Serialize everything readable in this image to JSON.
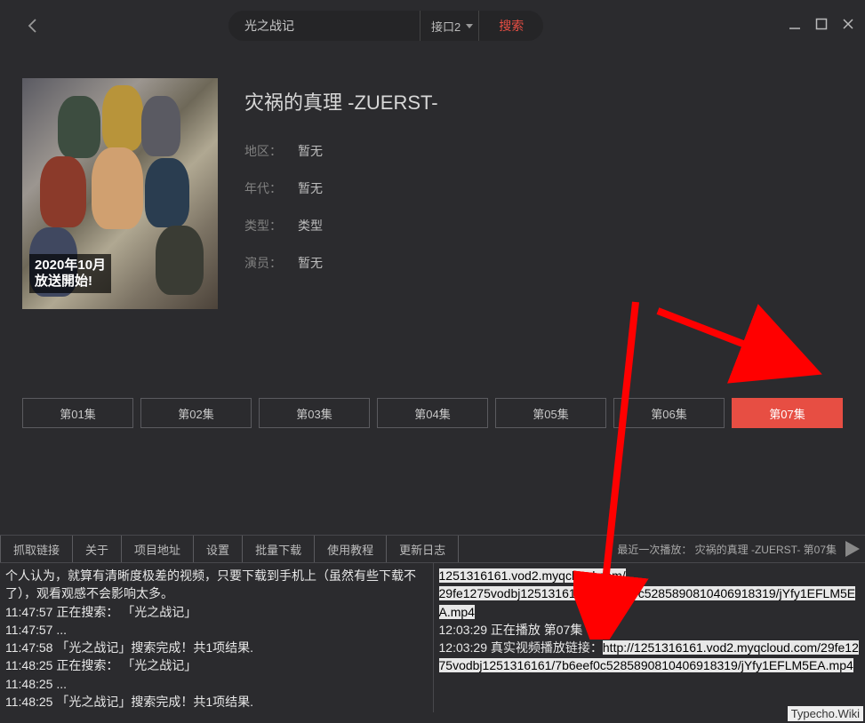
{
  "search": {
    "value": "光之战记",
    "interface": "接口2",
    "button": "搜索"
  },
  "poster_badge": {
    "line1": "2020年10月",
    "line2": "放送開始!"
  },
  "title": "灾祸的真理 -ZUERST-",
  "info": {
    "region_label": "地区：",
    "region_value": "暂无",
    "era_label": "年代：",
    "era_value": "暂无",
    "type_label": "类型：",
    "type_value": "类型",
    "cast_label": "演员：",
    "cast_value": "暂无"
  },
  "episodes": [
    "第01集",
    "第02集",
    "第03集",
    "第04集",
    "第05集",
    "第06集",
    "第07集"
  ],
  "active_ep_index": 6,
  "toolbar": {
    "buttons": [
      "抓取链接",
      "关于",
      "项目地址",
      "设置",
      "批量下载",
      "使用教程",
      "更新日志"
    ],
    "recent": "最近一次播放： 灾祸的真理 -ZUERST-  第07集"
  },
  "log_left": [
    "个人认为，就算有清晰度极差的视频，只要下载到手机上（虽然有些下载不了），观看观感不会影响太多。",
    "11:47:57 正在搜索： 「光之战记」",
    "11:47:57 ...",
    "11:47:58 「光之战记」搜索完成！共1项结果.",
    "11:48:25 正在搜索： 「光之战记」",
    "11:48:25 ...",
    "11:48:25 「光之战记」搜索完成！共1项结果."
  ],
  "log_right": {
    "l0": "1251316161.vod2.myqcloud.com/",
    "l1": "29fe1275vodbj1251316161/7b6eef0c5285890810406918319/jYfy1EFLM5EA.mp4",
    "l2": "12:03:29 正在播放 第07集",
    "l3a": "12:03:29 真实视频播放链接：",
    "l3b": "http://1251316161.vod2.myqcloud.com/29fe1275vodbj1251316161/7b6eef0c5285890810406918319/jYfy1EFLM5EA.mp4"
  },
  "watermark": "Typecho.Wiki"
}
